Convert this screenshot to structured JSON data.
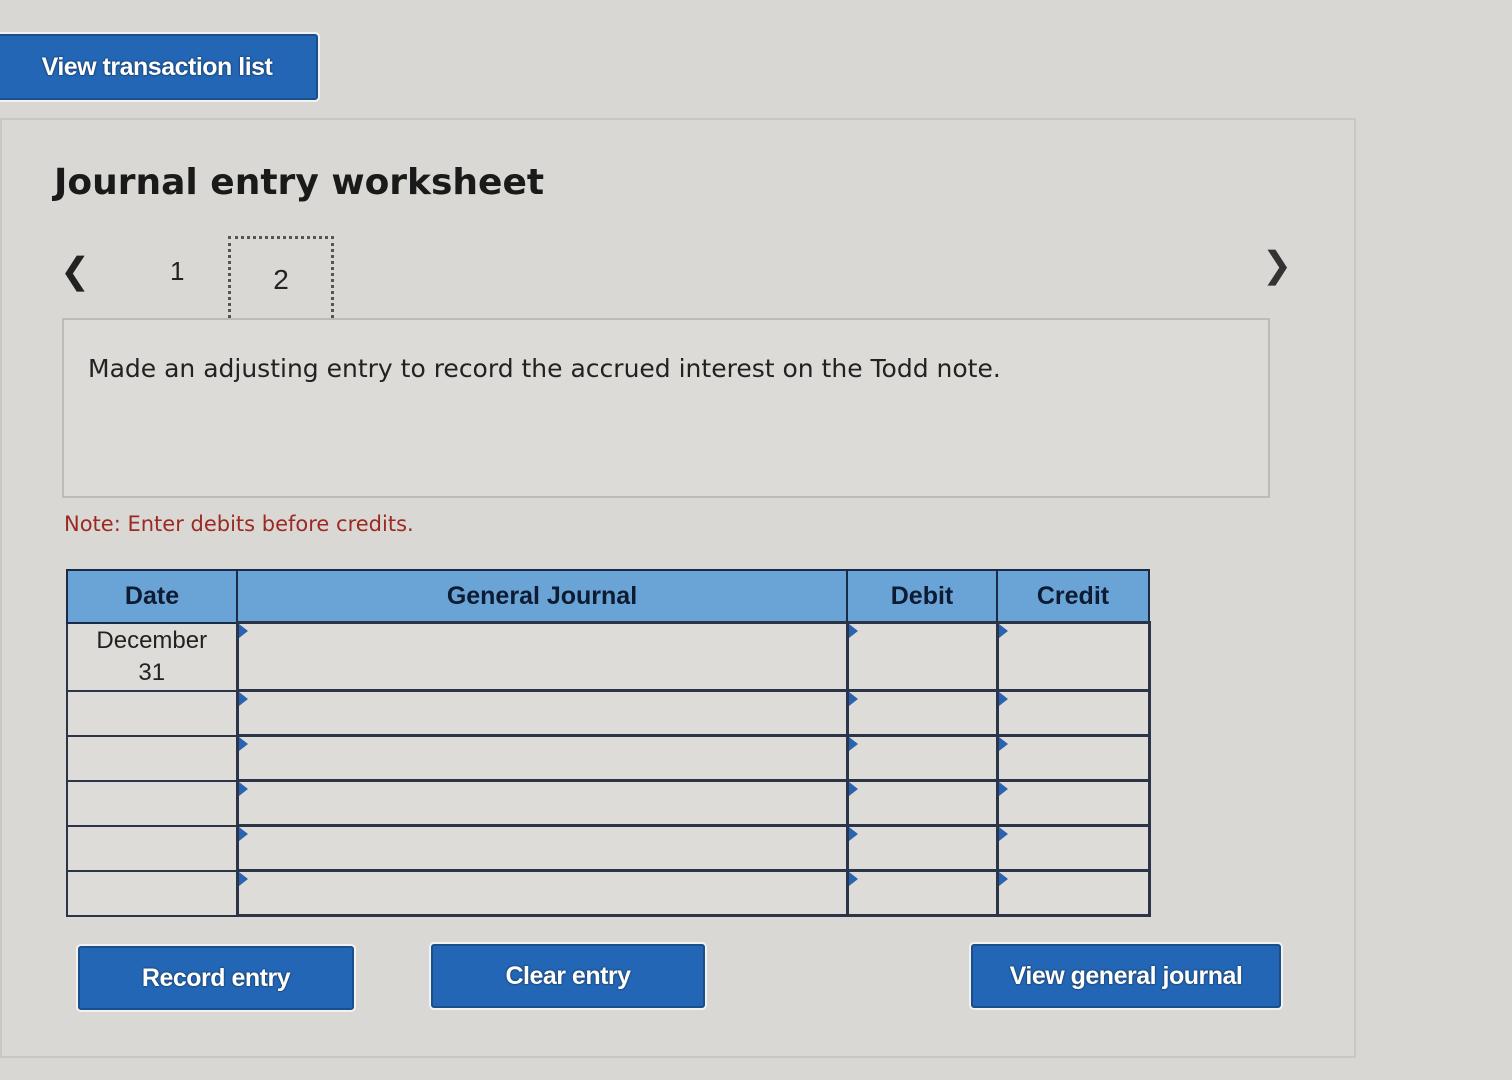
{
  "top": {
    "view_transaction_list": "View transaction list"
  },
  "worksheet": {
    "title": "Journal entry worksheet",
    "nav": {
      "prev_icon": "‹",
      "next_icon": "›",
      "pages": [
        "1",
        "2"
      ],
      "current_page": "2"
    },
    "description": "Made an adjusting entry to record the accrued interest on the Todd note.",
    "note": "Note: Enter debits before credits."
  },
  "table": {
    "headers": [
      "Date",
      "General Journal",
      "Debit",
      "Credit"
    ],
    "rows": [
      {
        "date": "December\n31",
        "account": "",
        "debit": "",
        "credit": ""
      },
      {
        "date": "",
        "account": "",
        "debit": "",
        "credit": ""
      },
      {
        "date": "",
        "account": "",
        "debit": "",
        "credit": ""
      },
      {
        "date": "",
        "account": "",
        "debit": "",
        "credit": ""
      },
      {
        "date": "",
        "account": "",
        "debit": "",
        "credit": ""
      },
      {
        "date": "",
        "account": "",
        "debit": "",
        "credit": ""
      }
    ]
  },
  "buttons": {
    "record": "Record entry",
    "clear": "Clear entry",
    "general": "View general journal"
  }
}
